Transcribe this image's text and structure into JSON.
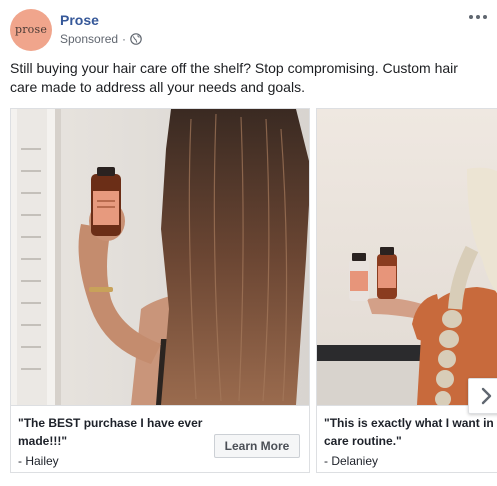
{
  "post": {
    "page_name": "Prose",
    "avatar_text": "prose",
    "sponsored_label": "Sponsored",
    "separator": "·",
    "text": "Still buying your hair care off the shelf? Stop compromising. Custom hair care made to address all your needs and goals."
  },
  "carousel": {
    "cards": [
      {
        "quote": "\"The BEST purchase I have ever made!!!\"",
        "author": "- Hailey",
        "cta": "Learn More"
      },
      {
        "quote": "\"This is exactly what I want in hair care routine.\"",
        "author": "- Delaniey"
      }
    ]
  },
  "icons": {
    "globe": "globe-icon",
    "more": "more-options-icon",
    "next": "chevron-right-icon"
  },
  "colors": {
    "page_name": "#365899",
    "avatar_bg": "#f0a58c",
    "bottle": "#8a3c1f",
    "label": "#e8a080"
  }
}
